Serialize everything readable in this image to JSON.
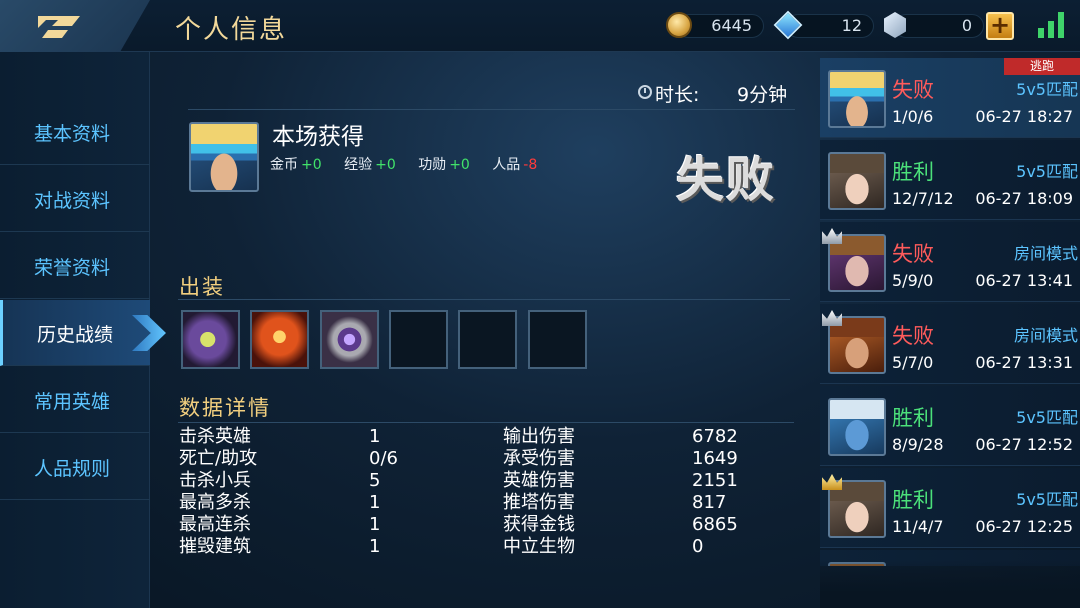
{
  "header": {
    "title": "个人信息",
    "back_icon": "back-arrow-icon",
    "currencies": {
      "gold": "6445",
      "diamond": "12",
      "voucher": "0"
    },
    "add_label": "+",
    "signal_icon": "signal-bars-icon",
    "colors": {
      "title": "#f2d89a",
      "accent": "#5cc4ff"
    }
  },
  "sidebar": {
    "items": [
      {
        "label": "基本资料"
      },
      {
        "label": "对战资料"
      },
      {
        "label": "荣誉资料"
      },
      {
        "label": "历史战绩",
        "active": true
      },
      {
        "label": "常用英雄"
      },
      {
        "label": "人品规则"
      }
    ]
  },
  "match_detail": {
    "duration_label": "时长:",
    "duration_value": "9分钟",
    "reward_title": "本场获得",
    "rewards": [
      {
        "label": "金币",
        "value": "+0"
      },
      {
        "label": "经验",
        "value": "+0"
      },
      {
        "label": "功勋",
        "value": "+0"
      },
      {
        "label": "人品",
        "value": "-8"
      }
    ],
    "result": "失败",
    "equipment_title": "出装",
    "equipment_slots": [
      "item-1",
      "item-2",
      "item-3",
      "",
      "",
      ""
    ],
    "stats_title": "数据详情",
    "stats_left": [
      {
        "label": "击杀英雄",
        "value": "1"
      },
      {
        "label": "死亡/助攻",
        "value": "0/6"
      },
      {
        "label": "击杀小兵",
        "value": "5"
      },
      {
        "label": "最高多杀",
        "value": "1"
      },
      {
        "label": "最高连杀",
        "value": "1"
      },
      {
        "label": "摧毁建筑",
        "value": "1"
      }
    ],
    "stats_right": [
      {
        "label": "输出伤害",
        "value": "6782"
      },
      {
        "label": "承受伤害",
        "value": "1649"
      },
      {
        "label": "英雄伤害",
        "value": "2151"
      },
      {
        "label": "推塔伤害",
        "value": "817"
      },
      {
        "label": "获得金钱",
        "value": "6865"
      },
      {
        "label": "中立生物",
        "value": "0"
      }
    ]
  },
  "history": [
    {
      "result": "失败",
      "mode": "5v5匹配",
      "kda": "1/0/6",
      "time": "06-27 18:27",
      "tag": "逃跑",
      "selected": true
    },
    {
      "result": "胜利",
      "mode": "5v5匹配",
      "kda": "12/7/12",
      "time": "06-27 18:09"
    },
    {
      "result": "失败",
      "mode": "房间模式",
      "kda": "5/9/0",
      "time": "06-27 13:41",
      "crown": "silver"
    },
    {
      "result": "失败",
      "mode": "房间模式",
      "kda": "5/7/0",
      "time": "06-27 13:31",
      "crown": "silver"
    },
    {
      "result": "胜利",
      "mode": "5v5匹配",
      "kda": "8/9/28",
      "time": "06-27 12:52"
    },
    {
      "result": "胜利",
      "mode": "5v5匹配",
      "kda": "11/4/7",
      "time": "06-27 12:25",
      "crown": "gold"
    }
  ]
}
